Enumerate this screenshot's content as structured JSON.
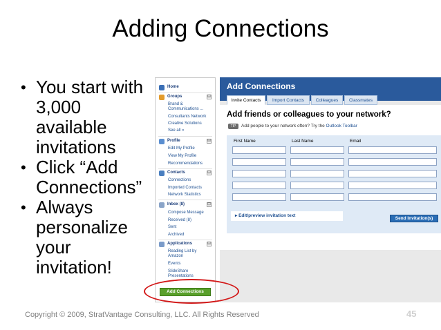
{
  "slide": {
    "title": "Adding Connections",
    "bullets": [
      {
        "lines": [
          "You start with",
          "3,000",
          "available",
          "invitations"
        ]
      },
      {
        "lines": [
          "Click “Add",
          "Connections”"
        ]
      },
      {
        "lines": [
          "Always",
          "personalize",
          "your",
          "invitation!"
        ]
      }
    ],
    "footer": "Copyright © 2009, StratVantage Consulting, LLC. All Rights Reserved",
    "page_number": "45"
  },
  "sidebar": {
    "home": "Home",
    "groups": "Groups",
    "group_links": [
      "Brand &",
      "Communications ...",
      "Consultants Network",
      "Creative Solutions",
      "See all »"
    ],
    "profile": "Profile",
    "profile_links": [
      "Edit My Profile",
      "View My Profile",
      "Recommendations"
    ],
    "contacts": "Contacts",
    "contact_links": [
      "Connections",
      "Imported Contacts",
      "Network Statistics"
    ],
    "inbox": "Inbox (8)",
    "inbox_links": [
      "Compose Message",
      "Received (8)",
      "Sent",
      "Archived"
    ],
    "applications": "Applications",
    "app_links": [
      "Reading List by",
      "Amazon",
      "Events",
      "SlideShare",
      "Presentations"
    ],
    "collapse_symbol": "⊟",
    "add_button": "Add Connections"
  },
  "panel": {
    "title": "Add Connections",
    "tabs": [
      "Invite Contacts",
      "Import Contacts",
      "Colleagues",
      "Classmates"
    ],
    "heading": "Add friends or colleagues to your network?",
    "tip_badge": "TIP",
    "tip_text": "Add people to your network often? Try the ",
    "tip_link": "Outlook Toolbar",
    "columns": [
      "First Name",
      "Last Name",
      "Email"
    ],
    "preview_label": "▸ Edit/preview invitation text",
    "send_button": "Send Invitation(s)"
  },
  "colors": {
    "header_blue": "#2a5a9c",
    "add_button_green": "#5aa02c",
    "highlight_red": "#d31919"
  }
}
